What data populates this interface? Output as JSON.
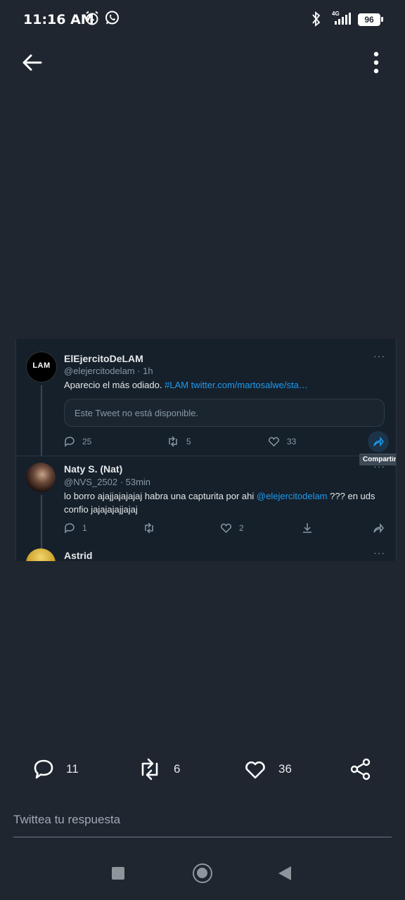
{
  "status": {
    "time": "11:16 AM",
    "network": "4G",
    "battery": "96"
  },
  "embed": {
    "tweets": [
      {
        "name": "ElEjercitoDeLAM",
        "handle": "@elejercitodelam · 1h",
        "text_plain": "Aparecio el más odiado. ",
        "text_hashtag": "#LAM",
        "text_link": " twitter.com/martosalwe/sta…",
        "quoted": "Este Tweet no está disponible.",
        "replies": "25",
        "retweets": "5",
        "likes": "33",
        "avatar_text": "LAM"
      },
      {
        "name": "Naty S. (Nat)",
        "handle": "@NVS_2502 · 53min",
        "text_plain": "lo borro ajajjajajajaj habra una capturita por ahi ",
        "text_mention": "@elejercitodelam",
        "text_end": " ??? en uds confio jajajajajjajaj",
        "replies": "1",
        "retweets": "",
        "likes": "2"
      },
      {
        "name": "Astrid"
      }
    ],
    "tooltip": "Compartir"
  },
  "actions": {
    "replies": "11",
    "retweets": "6",
    "likes": "36"
  },
  "reply": {
    "placeholder": "Twittea tu respuesta"
  },
  "icons": [
    "back-arrow-icon",
    "more-vertical-icon",
    "alarm-icon",
    "whatsapp-icon",
    "bluetooth-icon",
    "signal-icon",
    "battery-icon",
    "reply-icon",
    "retweet-icon",
    "like-icon",
    "download-icon",
    "share-icon",
    "stop-icon",
    "home-icon",
    "back-nav-icon"
  ]
}
